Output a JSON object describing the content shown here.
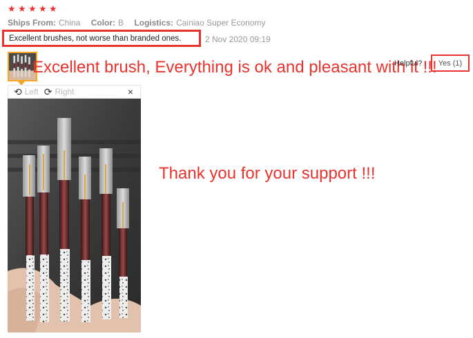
{
  "rating": {
    "stars": 5,
    "star_color": "#e9322d"
  },
  "meta": {
    "ships_from_label": "Ships From:",
    "ships_from_value": "China",
    "color_label": "Color:",
    "color_value": "B",
    "logistics_label": "Logistics:",
    "logistics_value": "Cainiao Super Economy"
  },
  "review": {
    "text": "Excellent brushes, not worse than branded ones.",
    "date": "2 Nov 2020 09:19"
  },
  "feedback": {
    "helpful_label": "Helpful?",
    "yes_label": "Yes (1)"
  },
  "annotations": {
    "buyer_note": "Excellent brush, Everything is ok and pleasant with it !!!",
    "seller_note": "Thank you for your support !!!"
  },
  "viewer": {
    "left_label": "Left",
    "right_label": "Right",
    "close_symbol": "×",
    "left_icon": "rotate-left-icon",
    "right_icon": "rotate-right-icon"
  },
  "colors": {
    "accent": "#e9322d",
    "thumb_border": "#f5a623"
  }
}
